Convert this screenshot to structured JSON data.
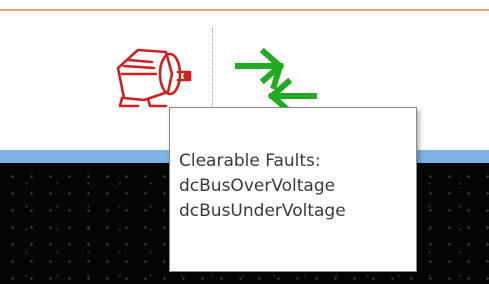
{
  "toolbar": {
    "motor": {
      "icon": "motor-icon",
      "color": "#cc2222"
    },
    "transfer": {
      "icon": "transfer-arrows-icon",
      "color": "#22aa22"
    }
  },
  "tooltip": {
    "title": "Clearable Faults:",
    "faults": [
      "dcBusOverVoltage",
      "dcBusUnderVoltage"
    ]
  },
  "colors": {
    "accent_rule": "#f0a070",
    "band": "#7fb3e4",
    "panel": "#050505"
  }
}
